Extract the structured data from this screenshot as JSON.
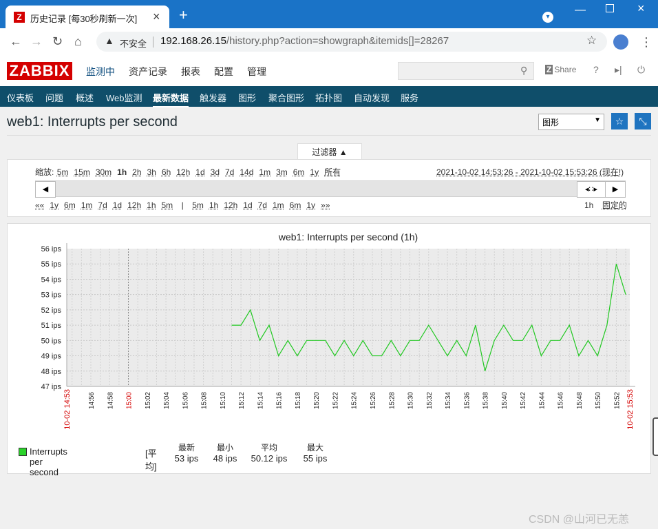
{
  "browser": {
    "tab_title": "历史记录 [每30秒刷新一次]",
    "tab_icon": "zabbix-favicon",
    "new_tab": "+",
    "security_label": "不安全",
    "url_host": "192.168.26.15",
    "url_path": "/history.php?action=showgraph&itemids[]=28267"
  },
  "header": {
    "logo": "ZABBIX",
    "menu": [
      "监测中",
      "资产记录",
      "报表",
      "配置",
      "管理"
    ],
    "share": "Share"
  },
  "subnav": {
    "items": [
      "仪表板",
      "问题",
      "概述",
      "Web监测",
      "最新数据",
      "触发器",
      "图形",
      "聚合图形",
      "拓扑图",
      "自动发现",
      "服务"
    ],
    "active": "最新数据"
  },
  "page": {
    "title": "web1: Interrupts per second",
    "view_select": "图形",
    "filter_tab": "过滤器 ▲"
  },
  "filter": {
    "zoom_label": "缩放:",
    "zoom_options": [
      "5m",
      "15m",
      "30m",
      "1h",
      "2h",
      "3h",
      "6h",
      "12h",
      "1d",
      "3d",
      "7d",
      "14d",
      "1m",
      "3m",
      "6m",
      "1y",
      "所有"
    ],
    "zoom_active": "1h",
    "time_range": "2021-10-02 14:53:26 - 2021-10-02 15:53:26 (现在!)",
    "move_back": [
      "««",
      "1y",
      "6m",
      "1m",
      "7d",
      "1d",
      "12h",
      "1h",
      "5m"
    ],
    "move_sep": "|",
    "move_fwd": [
      "5m",
      "1h",
      "12h",
      "1d",
      "7d",
      "1m",
      "6m",
      "1y",
      "»»"
    ],
    "period": "1h",
    "fixed": "固定的"
  },
  "chart_data": {
    "type": "line",
    "title": "web1: Interrupts per second (1h)",
    "ylabel": "",
    "yunit": "ips",
    "ylim": [
      47,
      56
    ],
    "y_ticks": [
      "56 ips",
      "55 ips",
      "54 ips",
      "53 ips",
      "52 ips",
      "51 ips",
      "50 ips",
      "49 ips",
      "48 ips",
      "47 ips"
    ],
    "x_start_label": "10-02 14:53",
    "x_end_label": "10-02 15:53",
    "x_tick_labels": [
      "14:56",
      "14:58",
      "15:00",
      "15:02",
      "15:04",
      "15:06",
      "15:08",
      "15:10",
      "15:12",
      "15:14",
      "15:16",
      "15:18",
      "15:20",
      "15:22",
      "15:24",
      "15:26",
      "15:28",
      "15:30",
      "15:32",
      "15:34",
      "15:36",
      "15:38",
      "15:40",
      "15:42",
      "15:44",
      "15:46",
      "15:48",
      "15:50",
      "15:52"
    ],
    "x_highlight": "15:00",
    "grid": true,
    "series": [
      {
        "name": "Interrupts per second",
        "color": "#20c820",
        "x": [
          "15:11",
          "15:12",
          "15:13",
          "15:14",
          "15:15",
          "15:16",
          "15:17",
          "15:18",
          "15:19",
          "15:20",
          "15:21",
          "15:22",
          "15:23",
          "15:24",
          "15:25",
          "15:26",
          "15:27",
          "15:28",
          "15:29",
          "15:30",
          "15:31",
          "15:32",
          "15:33",
          "15:34",
          "15:35",
          "15:36",
          "15:37",
          "15:38",
          "15:39",
          "15:40",
          "15:41",
          "15:42",
          "15:43",
          "15:44",
          "15:45",
          "15:46",
          "15:47",
          "15:48",
          "15:49",
          "15:50",
          "15:51",
          "15:52",
          "15:53"
        ],
        "values": [
          51,
          51,
          52,
          50,
          51,
          49,
          50,
          49,
          50,
          50,
          50,
          49,
          50,
          49,
          50,
          49,
          49,
          50,
          49,
          50,
          50,
          51,
          50,
          49,
          50,
          49,
          51,
          48,
          50,
          51,
          50,
          50,
          51,
          49,
          50,
          50,
          51,
          49,
          50,
          49,
          51,
          55,
          53
        ]
      }
    ],
    "legend": {
      "name": "Interrupts per second",
      "function": "[平均]",
      "stats": [
        {
          "label": "最新",
          "value": "53 ips"
        },
        {
          "label": "最小",
          "value": "48 ips"
        },
        {
          "label": "平均",
          "value": "50.12 ips"
        },
        {
          "label": "最大",
          "value": "55 ips"
        }
      ]
    }
  },
  "watermark": "CSDN @山河已无恙"
}
